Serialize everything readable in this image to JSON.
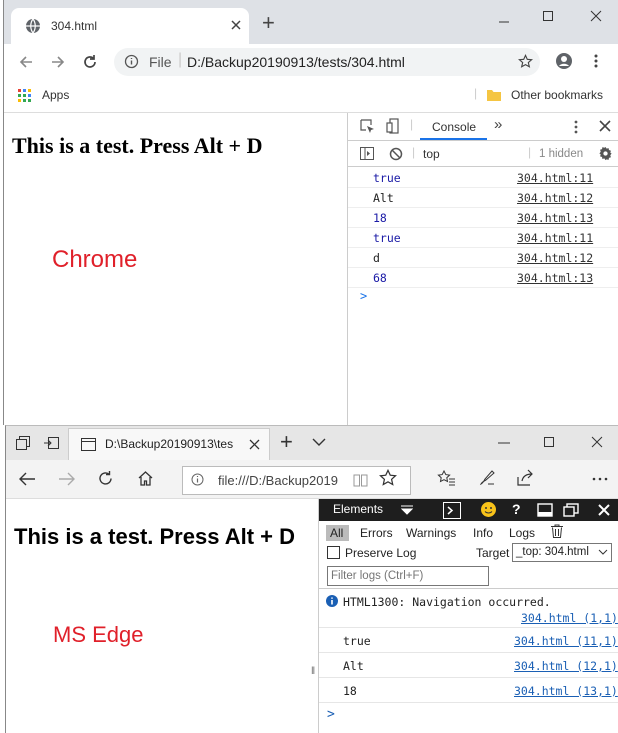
{
  "chrome": {
    "tab_title": "304.html",
    "new_tab": "+",
    "url_scheme": "File",
    "url": "D:/Backup20190913/tests/304.html",
    "bookmarks": {
      "apps": "Apps",
      "other": "Other bookmarks"
    },
    "page": {
      "heading": "This is a test. Press Alt + D",
      "label": "Chrome"
    },
    "devtools": {
      "tab": "Console",
      "context": "top",
      "hidden": "1 hidden",
      "rows": [
        {
          "value": "true",
          "source": "304.html:11",
          "kind": "bool"
        },
        {
          "value": "Alt",
          "source": "304.html:12",
          "kind": "str"
        },
        {
          "value": "18",
          "source": "304.html:13",
          "kind": "num"
        },
        {
          "value": "true",
          "source": "304.html:11",
          "kind": "bool"
        },
        {
          "value": "d",
          "source": "304.html:12",
          "kind": "str"
        },
        {
          "value": "68",
          "source": "304.html:13",
          "kind": "num"
        }
      ],
      "prompt": ">"
    },
    "colors": {
      "bool": "#1a1aa6",
      "num": "#1a1aa6",
      "str": "#222222",
      "accent": "#1a73e8"
    }
  },
  "edge": {
    "tab_title": "D:\\Backup20190913\\tes",
    "new_tab": "+",
    "url": "file:///D:/Backup2019",
    "page": {
      "heading": "This is a test. Press Alt + D",
      "label": "MS Edge"
    },
    "devtools": {
      "tab": "Elements",
      "question": "?",
      "filters": {
        "all": "All",
        "errors": "Errors",
        "warnings": "Warnings",
        "info": "Info",
        "logs": "Logs"
      },
      "preserve_log": "Preserve Log",
      "target_label": "Target",
      "target_value": "_top: 304.html",
      "filter_placeholder": "Filter logs (Ctrl+F)",
      "info_message": "HTML1300: Navigation occurred.",
      "info_source": "304.html (1,1)",
      "rows": [
        {
          "value": "true",
          "source": "304.html (11,1)"
        },
        {
          "value": "Alt",
          "source": "304.html (12,1)"
        },
        {
          "value": "18",
          "source": "304.html (13,1)"
        }
      ],
      "prompt": ">"
    }
  }
}
